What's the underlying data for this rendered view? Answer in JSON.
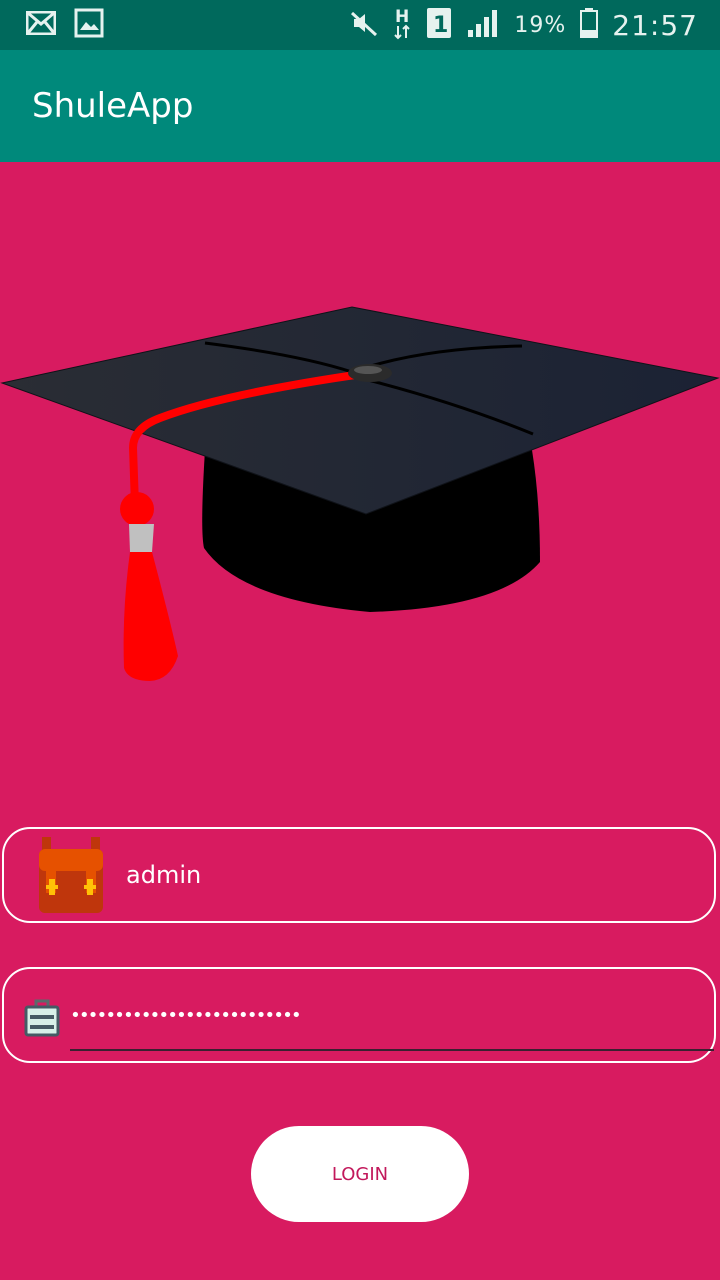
{
  "status_bar": {
    "icons": [
      "mail-icon",
      "image-icon",
      "mute-icon",
      "network-h-icon",
      "sim-1-icon",
      "signal-icon",
      "battery-icon"
    ],
    "battery_percent": "19%",
    "time": "21:57"
  },
  "app_bar": {
    "title": "ShuleApp"
  },
  "hero": {
    "icon": "graduation-cap-icon"
  },
  "form": {
    "username": {
      "icon": "backpack-icon",
      "value": "admin"
    },
    "password": {
      "icon": "briefcase-icon",
      "masked_value": "••••••••••••••••••••••••••"
    },
    "login_label": "LOGIN"
  },
  "colors": {
    "background": "#d81b60",
    "status_bar": "#00695c",
    "app_bar": "#00897b",
    "tassel": "#ff0000",
    "cap": "#1f2330"
  }
}
